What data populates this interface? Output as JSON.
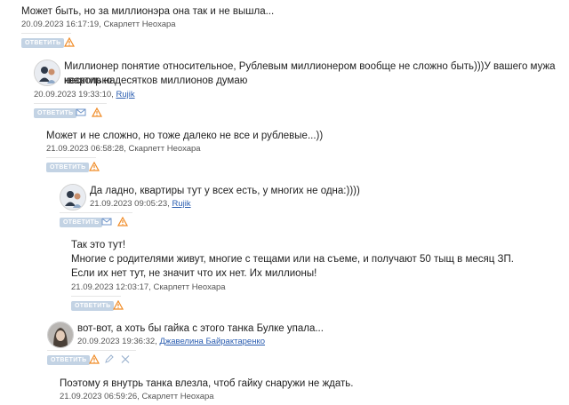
{
  "labels": {
    "reply": "ОТВЕТИТЬ"
  },
  "comments": [
    {
      "text": "Может быть, но за миллионэра она так и не вышла...",
      "date": "20.09.2023 16:17:19,",
      "author": "Скарлетт Неохара"
    },
    {
      "text1": "Миллионер понятие относительное, Рублевым миллионером вообще не сложно быть)))У вашего мужа квартир на",
      "text2": "несколько десятков миллионов думаю",
      "date": "20.09.2023 19:33:10,",
      "author": "Rujik"
    },
    {
      "text": "Может и не сложно, но тоже далеко не все и рублевые...))",
      "date": "21.09.2023 06:58:28,",
      "author": "Скарлетт Неохара"
    },
    {
      "text": "Да ладно, квартиры тут у всех есть, у многих не одна:))))",
      "date": "21.09.2023 09:05:23,",
      "author": "Rujik"
    },
    {
      "lines": [
        "Так это тут!",
        "Многие с родителями живут, многие с тещами или на съеме, и получают 50 тыщ в месяц ЗП.",
        "Если их нет тут, не значит что их нет. Их миллионы!"
      ],
      "date": "21.09.2023 12:03:17,",
      "author": "Скарлетт Неохара"
    },
    {
      "text": "вот-вот, а хоть бы гайка с этого танка Булке упала...",
      "date": "20.09.2023 19:36:32,",
      "author": "Джавелина Байрактаренко"
    },
    {
      "text": "Поэтому я внутрь танка влезла, чтоб гайку снаружи не ждать.",
      "date": "21.09.2023 06:59:26,",
      "author": "Скарлетт Неохара"
    }
  ]
}
